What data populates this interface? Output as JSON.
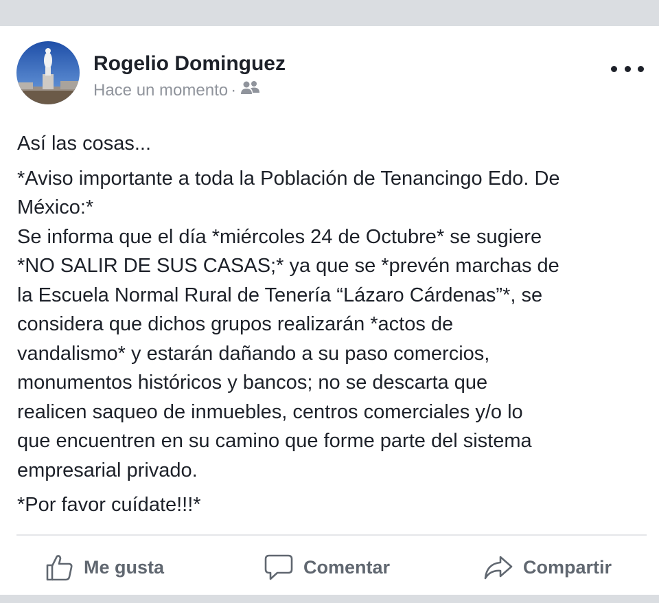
{
  "post": {
    "author": "Rogelio Dominguez",
    "timestamp": "Hace un momento",
    "separator": "·",
    "audience_icon": "friends-icon",
    "more_icon": "more-options-icon",
    "intro": "Así las cosas...",
    "body_lines": [
      "*Aviso importante a toda la Población de Tenancingo Edo. De",
      "México:*",
      "Se informa que el día *miércoles 24 de Octubre* se sugiere",
      "*NO SALIR DE SUS CASAS;* ya que se *prevén marchas de",
      "la Escuela Normal Rural de Tenería “Lázaro Cárdenas”*, se",
      "considera que dichos grupos realizarán *actos de",
      "vandalismo* y estarán dañando a su paso comercios,",
      "monumentos históricos y bancos; no se descarta que",
      "realicen saqueo de inmuebles, centros comerciales y/o lo",
      "que encuentren en su camino que forme parte del sistema",
      "empresarial privado."
    ],
    "closing": "*Por favor cuídate!!!*"
  },
  "actions": {
    "like": {
      "label": "Me gusta",
      "icon": "thumbs-up-icon"
    },
    "comment": {
      "label": "Comentar",
      "icon": "comment-icon"
    },
    "share": {
      "label": "Compartir",
      "icon": "share-icon"
    }
  },
  "colors": {
    "author": "#1d2129",
    "meta": "#90949c",
    "action": "#606770",
    "background": "#dadde1"
  }
}
